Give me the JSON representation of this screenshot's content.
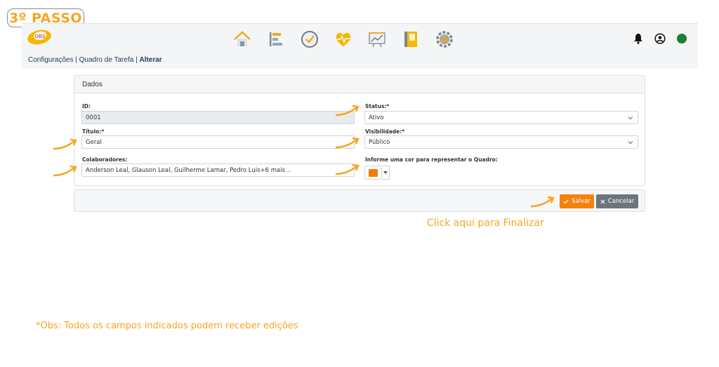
{
  "step_badge": "3º PASSO",
  "topbar": {
    "logo_text": "OBS",
    "nav": [
      "home-icon",
      "task-board-icon",
      "check-circle-icon",
      "heart-pulse-icon",
      "chart-board-icon",
      "notebook-icon",
      "settings-gear-icon"
    ],
    "right": [
      "bell-icon",
      "user-circle-icon",
      "status-dot-icon"
    ],
    "accent": "#f5a623",
    "status_color": "#1e7e34"
  },
  "breadcrumb": {
    "item1": "Configurações",
    "sep1": " | ",
    "item2": "Quadro de Tarefa",
    "sep2": " | ",
    "current": "Alterar"
  },
  "form": {
    "header": "Dados",
    "id_label": "ID:",
    "id_value": "0001",
    "titulo_label": "Título:*",
    "titulo_value": "Geral",
    "colaboradores_label": "Colaboradores:",
    "colaboradores_value": "Anderson Leal, Glauson Leal, Guilherme Lamar, Pedro Luis+6 mais ..",
    "status_label": "Status:*",
    "status_value": "Ativo",
    "visibilidade_label": "Visibilidade:*",
    "visibilidade_value": "Público",
    "cor_label": "Informe uma cor para representar o Quadro:",
    "cor_value": "#f57c00"
  },
  "actions": {
    "save_label": "Salvar",
    "cancel_label": "Cancelar",
    "save_color": "#f5820d",
    "cancel_color": "#6c757d"
  },
  "hint": "Click aqui para Finalizar",
  "obs": "*Obs: Todos os campos indicados podem receber edições"
}
